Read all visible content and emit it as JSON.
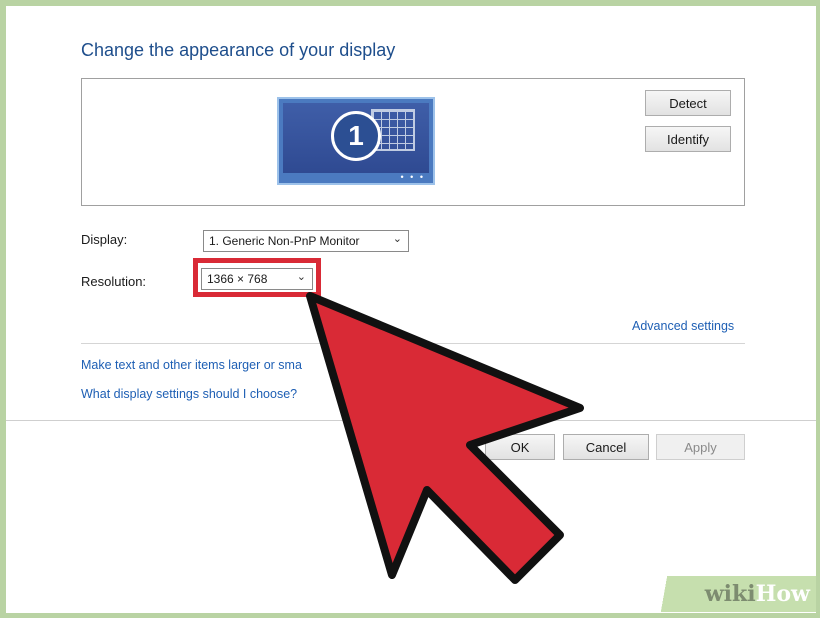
{
  "page": {
    "title": "Change the appearance of your display"
  },
  "preview": {
    "monitor_number": "1",
    "detect_label": "Detect",
    "identify_label": "Identify"
  },
  "settings": {
    "display_label": "Display:",
    "display_value": "1. Generic Non-PnP Monitor",
    "resolution_label": "Resolution:",
    "resolution_value": "1366 × 768"
  },
  "links": {
    "advanced": "Advanced settings",
    "larger_text": "Make text and other items larger or sma",
    "choose": "What display settings should I choose?"
  },
  "footer": {
    "ok_label": "OK",
    "cancel_label": "Cancel",
    "apply_label": "Apply"
  },
  "watermark": {
    "part1": "wiki",
    "part2": "How"
  },
  "colors": {
    "highlight": "#d92a36",
    "arrow": "#d92a36",
    "accent": "#1e5fb4"
  },
  "icons": [
    "monitor-icon",
    "chevron-down-icon",
    "cursor-arrow-icon"
  ]
}
